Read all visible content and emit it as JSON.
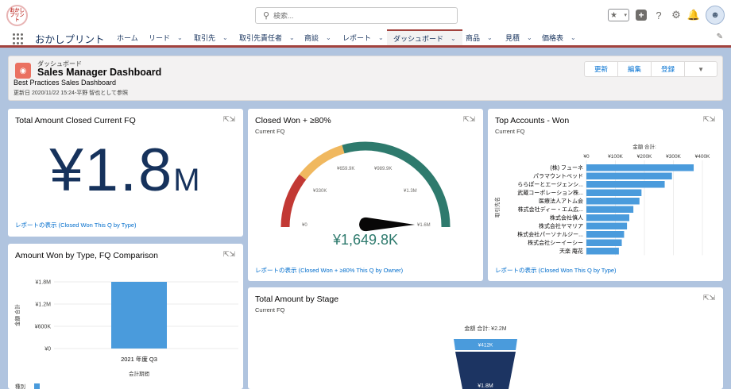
{
  "header": {
    "logo_text": "おかし\nプリント",
    "search_placeholder": "検索...",
    "icons": [
      "star-icon",
      "chevron-down-icon",
      "plus-icon",
      "help-icon",
      "gear-icon",
      "bell-icon",
      "avatar-icon"
    ]
  },
  "nav": {
    "app_name": "おかしプリント",
    "tabs": [
      {
        "label": "ホーム",
        "dropdown": false,
        "active": false
      },
      {
        "label": "リード",
        "dropdown": true,
        "active": false
      },
      {
        "label": "取引先",
        "dropdown": true,
        "active": false
      },
      {
        "label": "取引先責任者",
        "dropdown": true,
        "active": false
      },
      {
        "label": "商談",
        "dropdown": true,
        "active": false
      },
      {
        "label": "レポート",
        "dropdown": true,
        "active": false
      },
      {
        "label": "ダッシュボード",
        "dropdown": true,
        "active": true
      },
      {
        "label": "商品",
        "dropdown": true,
        "active": false
      },
      {
        "label": "見積",
        "dropdown": true,
        "active": false
      },
      {
        "label": "価格表",
        "dropdown": true,
        "active": false
      }
    ]
  },
  "dashboard": {
    "type_label": "ダッシュボード",
    "title": "Sales Manager Dashboard",
    "subtitle": "Best Practices Sales Dashboard",
    "updated": "更新日 2020/11/22 15:24-平野 智也として参照",
    "buttons": {
      "refresh": "更新",
      "edit": "編集",
      "subscribe": "登録"
    }
  },
  "cards": {
    "total_amount": {
      "title": "Total Amount Closed Current FQ",
      "value_main": "¥1.8",
      "value_unit": "M",
      "footer": "レポートの表示 (Closed Won This Q by Type)"
    },
    "closed_won": {
      "title": "Closed Won + ≥80%",
      "subtitle": "Current FQ",
      "gauge_value": "¥1,649.8K",
      "gauge_labels": [
        "¥0",
        "¥330K",
        "¥659.9K",
        "¥989.9K",
        "¥1.3M",
        "¥1.6M"
      ],
      "footer": "レポートの表示 (Closed Won + ≥80% This Q by Owner)"
    },
    "top_accounts": {
      "title": "Top Accounts - Won",
      "subtitle": "Current FQ",
      "footer": "レポートの表示 (Closed Won This Q by Type)"
    },
    "amount_by_type": {
      "title": "Amount Won by Type, FQ Comparison"
    },
    "by_stage": {
      "title": "Total Amount by Stage",
      "subtitle": "Current FQ"
    }
  },
  "chart_data": [
    {
      "type": "bar",
      "orientation": "horizontal",
      "title": "Top Accounts - Won",
      "xlabel": "金額 合計:",
      "ylabel": "取引先名",
      "ticks": [
        "¥0",
        "¥100K",
        "¥200K",
        "¥300K",
        "¥400K"
      ],
      "xlim": [
        0,
        400
      ],
      "categories": [
        "(株) フューネ",
        "パラマウントベッド",
        "ららぽーとエージェンシ...",
        "武蔵コーポレーション株...",
        "医療法人アトム会",
        "株式会社ディー・エム広...",
        "株式会社慎人",
        "株式会社ヤマリア",
        "株式会社パーソナルジー...",
        "株式会社シーイーシー",
        "天楽 庵花"
      ],
      "values": [
        370,
        295,
        270,
        190,
        183,
        162,
        148,
        140,
        130,
        122,
        112
      ],
      "color": "#4a9bdc"
    },
    {
      "type": "bar",
      "title": "Amount Won by Type, FQ Comparison",
      "xlabel": "会計期間",
      "ylabel": "金額 合計",
      "ticks": [
        "¥0",
        "¥600K",
        "¥1.2M",
        "¥1.8M"
      ],
      "ylim": [
        0,
        1.8
      ],
      "categories": [
        "2021 年度 Q3"
      ],
      "values": [
        1.8
      ],
      "legend_label": "種別",
      "color": "#4a9bdc"
    },
    {
      "type": "funnel",
      "title": "Total Amount by Stage",
      "total_label": "金額 合計: ¥2.2M",
      "segments": [
        {
          "label": "¥412K",
          "value": 0.412,
          "color": "#4a9bdc"
        },
        {
          "label": "¥1.8M",
          "value": 1.8,
          "color": "#1c3462"
        }
      ]
    }
  ]
}
